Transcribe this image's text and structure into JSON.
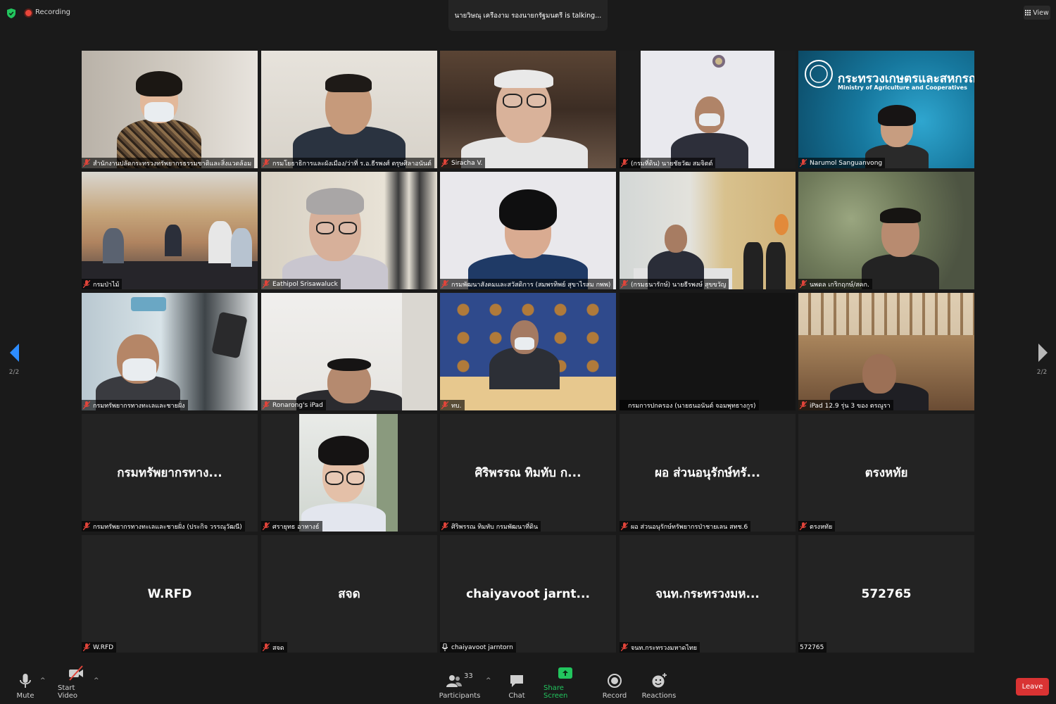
{
  "topbar": {
    "recording_label": "Recording",
    "talking": "นายวิษณุ เครืองาม รองนายกรัฐมนตรี is talking...",
    "view_label": "View"
  },
  "pagination": {
    "left": "2/2",
    "right": "2/2"
  },
  "tiles": [
    {
      "label": "สำนักงานปลัดกระทรวงทรัพยากรธรรมชาติและสิ่งแวดล้อม",
      "muted": true
    },
    {
      "label": "กรมโยธาธิการและผังเมือง/ว่าที่ ร.อ.ธีรพงศ์ ตรุษศิลาอนันต์",
      "muted": true
    },
    {
      "label": "Siracha V.",
      "muted": true
    },
    {
      "label": "(กรมที่ดิน) นายชัยวัฒ สมจิตต์",
      "muted": true
    },
    {
      "label": "Narumol Sanguanvong",
      "muted": true,
      "banner": "กระทรวงเกษตรและสหกรณ์",
      "banner_sub": "Ministry of Agriculture and Cooperatives"
    },
    {
      "label": "กรมป่าไม้",
      "muted": true
    },
    {
      "label": "Eathipol Srisawaluck",
      "muted": true
    },
    {
      "label": "กรมพัฒนาสังคมและสวัสดิการ (สมพรทิพย์ สุขาไรสม กพพ)",
      "muted": true
    },
    {
      "label": "(กรมธนารักษ์) นายธีรพงษ์ สุขขวัญ",
      "muted": true
    },
    {
      "label": "นพดล เกริกฤกษ์/สคก.",
      "muted": true
    },
    {
      "label": "กรมทรัพยากรทางทะเลและชายฝั่ง",
      "muted": true
    },
    {
      "label": "Ronarong's iPad",
      "muted": true
    },
    {
      "label": "ทบ.",
      "muted": true
    },
    {
      "label": "กรมการปกครอง (นายธนอนันต์ จอมพุทธางกูร)",
      "muted": false
    },
    {
      "label": "iPad 12.9 รุ่น 3 ของ ตรณูรา",
      "muted": true
    },
    {
      "label": "กรมทรัพยากรทางทะเลและชายฝั่ง (ประกิจ วรรณุวัฒนี)",
      "muted": true,
      "display": "กรมทรัพยากรทาง..."
    },
    {
      "label": "ศรายุทธ อาทางธ์",
      "muted": true
    },
    {
      "label": "ศิริพรรณ ทิมทับ กรมพัฒนาที่ดิน",
      "muted": true,
      "display": "ศิริพรรณ ทิมทับ ก..."
    },
    {
      "label": "ผอ ส่วนอนุรักษ์ทรัพยากรป่าชายเลน สทช.6",
      "muted": true,
      "display": "ผอ ส่วนอนุรักษ์ทรั..."
    },
    {
      "label": "ตรงหทัย",
      "muted": true,
      "display": "ตรงหทัย"
    },
    {
      "label": "W.RFD",
      "muted": true,
      "display": "W.RFD"
    },
    {
      "label": "สจด",
      "muted": true,
      "display": "สจด"
    },
    {
      "label": "chaiyavoot jarntorn",
      "muted": false,
      "display": "chaiyavoot jarnt..."
    },
    {
      "label": "จนท.กระทรวงมหาดไทย",
      "muted": true,
      "display": "จนท.กระทรวงมห..."
    },
    {
      "label": "572765",
      "muted": false,
      "display": "572765"
    }
  ],
  "toolbar": {
    "mute": "Mute",
    "start_video": "Start Video",
    "participants": "Participants",
    "participants_count": "33",
    "chat": "Chat",
    "share_screen": "Share Screen",
    "record": "Record",
    "reactions": "Reactions",
    "leave": "Leave"
  },
  "colors": {
    "accent_green": "#22c55e",
    "leave_red": "#d93333",
    "nav_blue": "#2d8cff",
    "muted_red": "#e0443a"
  }
}
